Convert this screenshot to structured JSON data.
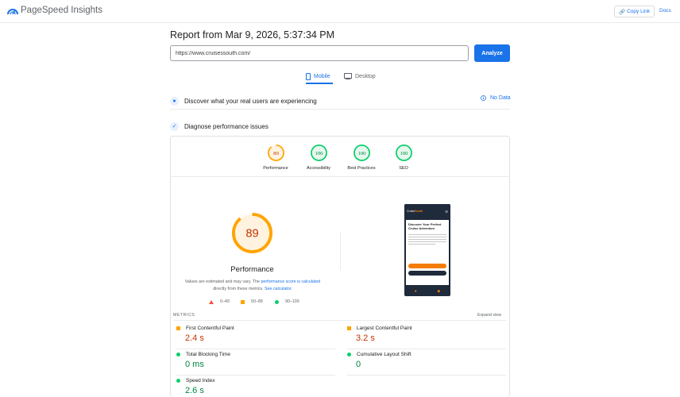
{
  "header": {
    "brand": "PageSpeed Insights",
    "copy_link": "Copy Link",
    "docs": "Docs"
  },
  "report": {
    "title": "Report from Mar 9, 2026, 5:37:34 PM",
    "url_value": "https://www.cruisessouth.com/",
    "analyze": "Analyze"
  },
  "tabs": [
    {
      "label": "Mobile",
      "active": true
    },
    {
      "label": "Desktop",
      "active": false
    }
  ],
  "crux": {
    "label": "Discover what your real users are experiencing",
    "no_data": "No Data"
  },
  "diagnose": {
    "label": "Diagnose performance issues"
  },
  "categories": [
    {
      "label": "Performance",
      "score": 89,
      "color": "#ffa400",
      "bg": "#fff3e0"
    },
    {
      "label": "Accessibility",
      "score": 100,
      "color": "#0cce6b",
      "bg": "#e6f8ee"
    },
    {
      "label": "Best Practices",
      "score": 100,
      "color": "#0cce6b",
      "bg": "#e6f8ee"
    },
    {
      "label": "SEO",
      "score": 100,
      "color": "#0cce6b",
      "bg": "#e6f8ee"
    }
  ],
  "performance": {
    "score": 89,
    "title": "Performance",
    "note_prefix": "Values are estimated and may vary. The",
    "note_link": "performance score is calculated",
    "note_middle": "directly from these metrics.",
    "note_link2": "See calculator."
  },
  "legend": {
    "fail": "0–49",
    "average": "50–89",
    "pass": "90–100"
  },
  "phone": {
    "logo_a": "Cruise",
    "logo_b": "South",
    "heading": "Discover Your Perfect Cruise Adventure"
  },
  "metrics": {
    "label": "METRICS",
    "expand": "Expand view",
    "items": [
      {
        "label": "First Contentful Paint",
        "value": "2.4 s",
        "rating": "average",
        "color": "#c33300"
      },
      {
        "label": "Largest Contentful Paint",
        "value": "3.2 s",
        "rating": "average",
        "color": "#c33300"
      },
      {
        "label": "Total Blocking Time",
        "value": "0 ms",
        "rating": "pass",
        "color": "#018642"
      },
      {
        "label": "Cumulative Layout Shift",
        "value": "0",
        "rating": "pass",
        "color": "#018642"
      },
      {
        "label": "Speed Index",
        "value": "2.6 s",
        "rating": "pass",
        "color": "#018642"
      }
    ]
  }
}
